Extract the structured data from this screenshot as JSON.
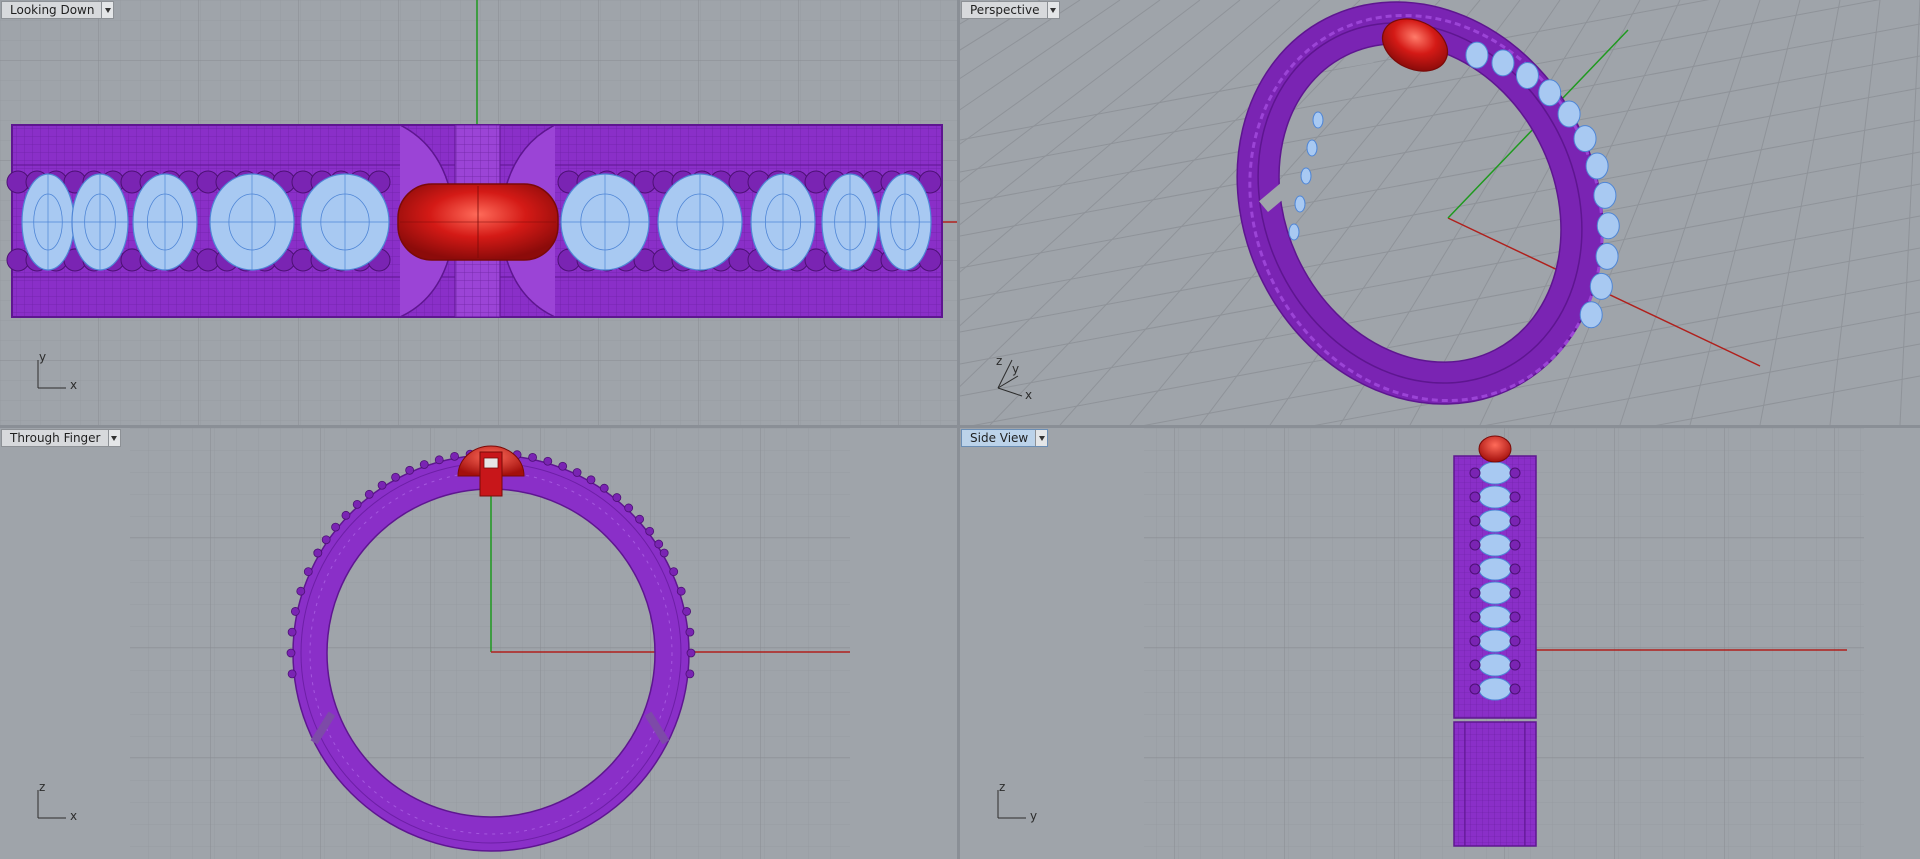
{
  "viewports": {
    "top": {
      "title": "Looking Down",
      "axes": [
        "y",
        "x"
      ]
    },
    "persp": {
      "title": "Perspective",
      "axes": [
        "z",
        "y",
        "x"
      ]
    },
    "front": {
      "title": "Through Finger",
      "axes": [
        "z",
        "x"
      ]
    },
    "side": {
      "title": "Side View",
      "axes": [
        "z",
        "y"
      ]
    }
  },
  "colors": {
    "background": "#9fa4aa",
    "grid_minor": "#979ba1",
    "grid_major": "#858a90",
    "metal": "#8a2fc8",
    "metal_dark": "#5e1690",
    "stone_blue": "#a8c9f2",
    "stone_wire": "#4f86d6",
    "gem_red": "#d41a16",
    "axis_x": "#b0201c",
    "axis_y": "#1f9a1f",
    "active_view": "#bcd3ea"
  },
  "icons": [
    "dropdown-arrow-icon",
    "axis-triad-icon"
  ]
}
